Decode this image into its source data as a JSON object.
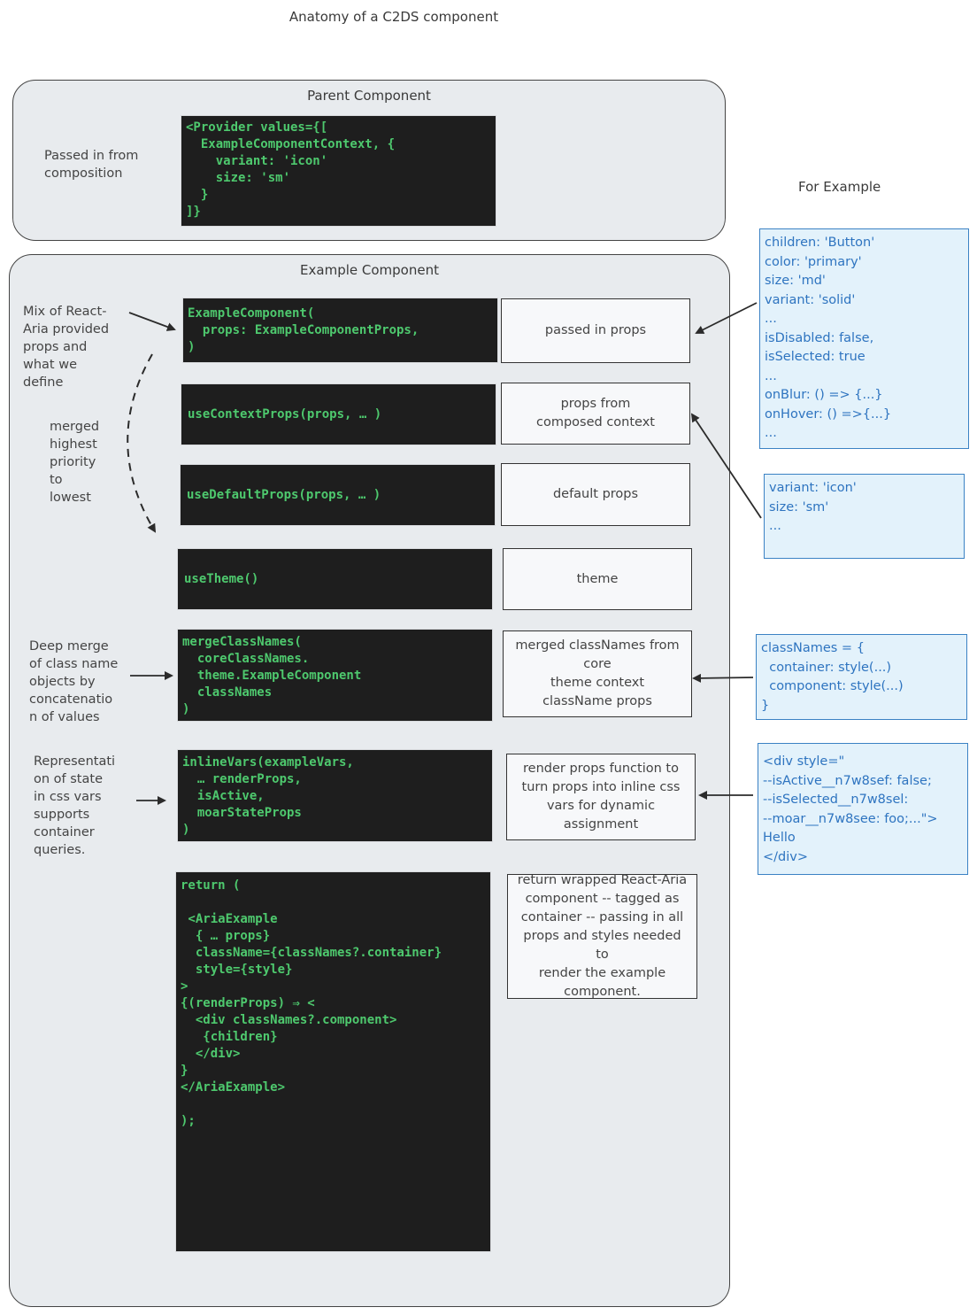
{
  "title": "Anatomy of a C2DS component",
  "parent_component": {
    "title": "Parent Component",
    "note": "Passed in from\ncomposition",
    "code": "<Provider values={[\n  ExampleComponentContext, {\n    variant: 'icon'\n    size: 'sm'\n  }\n]}"
  },
  "for_example_label": "For Example",
  "example_component": {
    "title": "Example Component",
    "notes": {
      "mix": "Mix of React-\nAria provided\nprops and\nwhat we\ndefine",
      "merged": "merged\nhighest\npriority\nto\nlowest",
      "deep_merge": "Deep merge\nof class name\nobjects by\nconcatenatio\nn of values",
      "representation": "Representati\non of state\nin css vars\nsupports\ncontainer\nqueries."
    },
    "rows": [
      {
        "code": "ExampleComponent(\n  props: ExampleComponentProps,\n)",
        "desc": "passed in props"
      },
      {
        "code": "useContextProps(props, … )",
        "desc": "props from\ncomposed context"
      },
      {
        "code": "useDefaultProps(props, … )",
        "desc": "default props"
      },
      {
        "code": "useTheme()",
        "desc": "theme"
      },
      {
        "code": "mergeClassNames(\n  coreClassNames.\n  theme.ExampleComponent\n  classNames\n)",
        "desc": "merged classNames from\ncore\ntheme context\nclassName props"
      },
      {
        "code": "inlineVars(exampleVars,\n  … renderProps,\n  isActive,\n  moarStateProps\n)",
        "desc": "render props function to\nturn props into inline css\nvars for dynamic\nassignment"
      },
      {
        "code": "return (\n\n <AriaExample\n  { … props}\n  className={classNames?.container}\n  style={style}\n>\n{(renderProps) ⇒ <\n  <div classNames?.component>\n   {children}\n  </div>\n}\n</AriaExample>\n\n);",
        "desc": "return wrapped React-Aria\ncomponent -- tagged as\ncontainer -- passing in all\nprops and styles needed to\nrender the example\ncomponent."
      }
    ]
  },
  "examples": {
    "passed_props": "children: 'Button'\ncolor: 'primary'\nsize: 'md'\nvariant: 'solid'\n...\nisDisabled: false,\nisSelected: true\n...\nonBlur: () => {...}\nonHover: () =>{...}\n...",
    "context_props": "variant: 'icon'\nsize: 'sm'\n...",
    "class_names": "classNames = {\n  container: style(...)\n  component: style(...)\n}",
    "inline_vars": "<div style=\"\n--isActive__n7w8sef: false;\n--isSelected__n7w8sel:\n--moar__n7w8see: foo;...\">\nHello\n</div>"
  },
  "colors": {
    "code_bg": "#1e1e1e",
    "code_text": "#4ec96e",
    "container_bg": "#e8ebee",
    "example_bg": "#e3f2fb",
    "example_border": "#3b82c4",
    "example_text": "#2e74c0"
  }
}
